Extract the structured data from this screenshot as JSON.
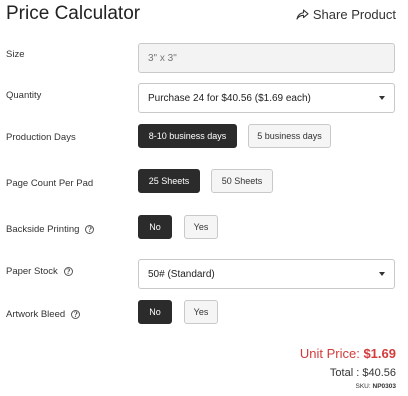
{
  "header": {
    "title": "Price Calculator",
    "share_label": "Share Product"
  },
  "size": {
    "label": "Size",
    "value": "3\" x 3\""
  },
  "quantity": {
    "label": "Quantity",
    "selected": "Purchase 24 for $40.56 ($1.69 each)"
  },
  "production_days": {
    "label": "Production Days",
    "options": [
      "8-10 business days",
      "5 business days"
    ],
    "selected": "8-10 business days"
  },
  "page_count": {
    "label": "Page Count Per Pad",
    "options": [
      "25 Sheets",
      "50 Sheets"
    ],
    "selected": "25 Sheets"
  },
  "backside_printing": {
    "label": "Backside Printing",
    "options": [
      "No",
      "Yes"
    ],
    "selected": "No"
  },
  "paper_stock": {
    "label": "Paper Stock",
    "selected": "50# (Standard)"
  },
  "artwork_bleed": {
    "label": "Artwork Bleed",
    "options": [
      "No",
      "Yes"
    ],
    "selected": "No"
  },
  "summary": {
    "unit_price_label": "Unit Price:",
    "unit_price": "$1.69",
    "total_label": "Total :",
    "total": "$40.56",
    "sku_label": "SKU:",
    "sku": "NP0303"
  },
  "colors": {
    "accent_price": "#d33b3b",
    "active_button": "#2b2b2b"
  },
  "icons": [
    "share-icon",
    "info-icon",
    "chevron-down-icon"
  ]
}
